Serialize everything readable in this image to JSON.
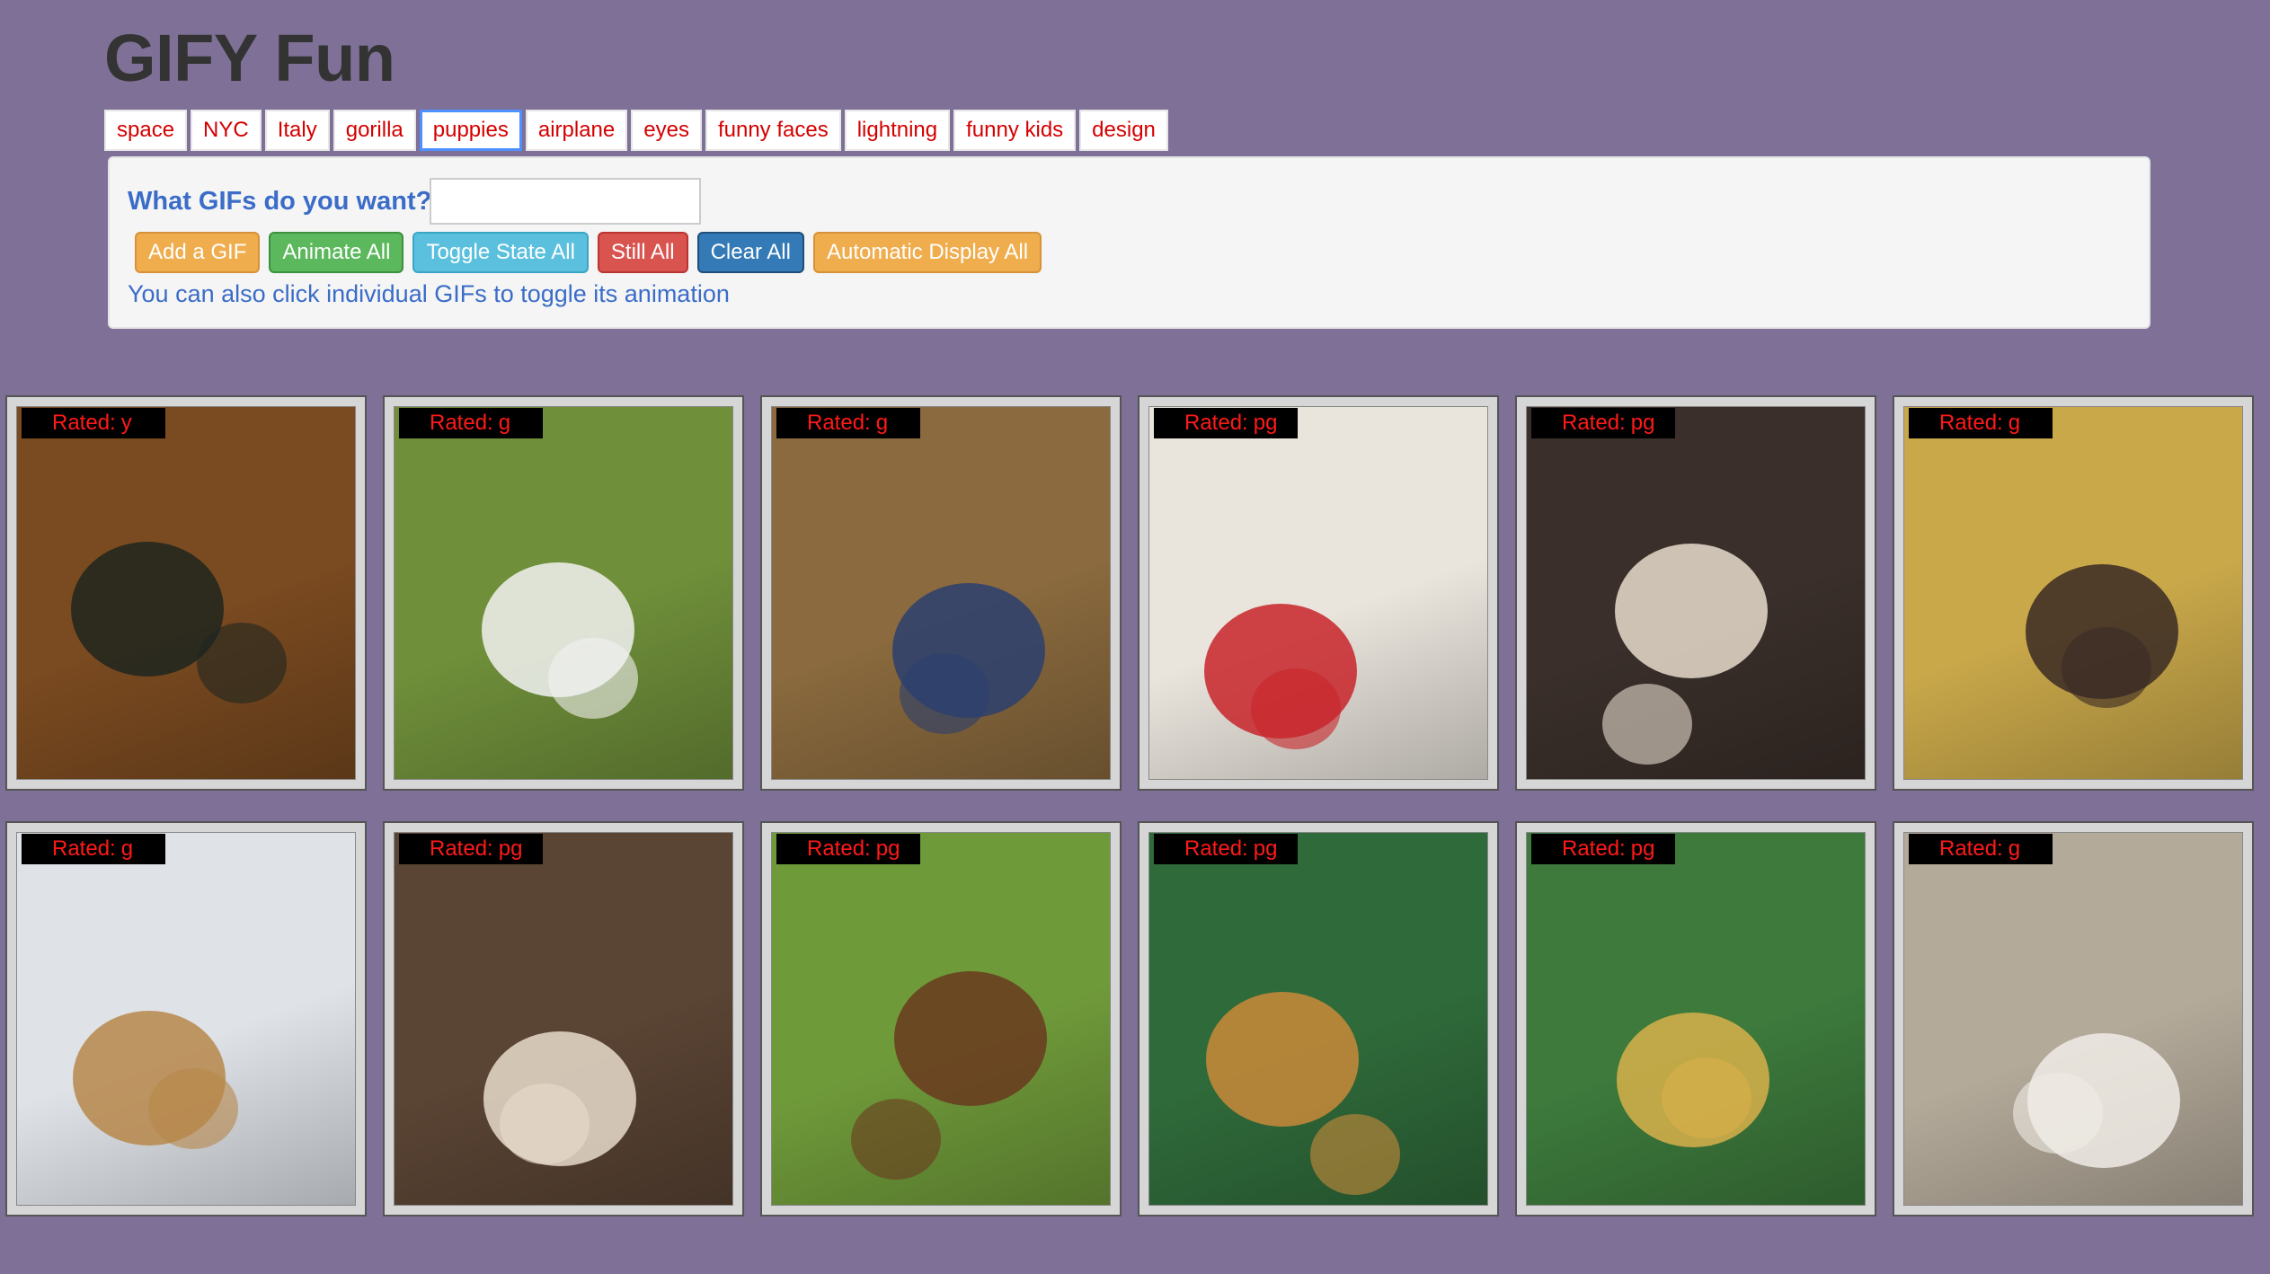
{
  "page": {
    "title": "GIFY Fun"
  },
  "topics": [
    {
      "label": "space",
      "active": false
    },
    {
      "label": "NYC",
      "active": false
    },
    {
      "label": "Italy",
      "active": false
    },
    {
      "label": "gorilla",
      "active": false
    },
    {
      "label": "puppies",
      "active": true
    },
    {
      "label": "airplane",
      "active": false
    },
    {
      "label": "eyes",
      "active": false
    },
    {
      "label": "funny faces",
      "active": false
    },
    {
      "label": "lightning",
      "active": false
    },
    {
      "label": "funny kids",
      "active": false
    },
    {
      "label": "design",
      "active": false
    }
  ],
  "controls": {
    "query_label": "What GIFs do you want?",
    "query_value": "",
    "add_label": "Add a GIF",
    "animate_label": "Animate All",
    "toggle_label": "Toggle State All",
    "still_label": "Still All",
    "clear_label": "Clear All",
    "auto_label": "Automatic Display All",
    "help_text": "You can also click individual GIFs to toggle its animation"
  },
  "rating_prefix": "Rated:",
  "gifs": [
    {
      "rating": "y",
      "bg": "#7a4a20",
      "fg": "#1f261f",
      "desc": "cartoon-dalmatian-puppies"
    },
    {
      "rating": "g",
      "bg": "#6f8f3a",
      "fg": "#f2f2f2",
      "desc": "puppies-in-laundry-basket"
    },
    {
      "rating": "g",
      "bg": "#8a6a3e",
      "fg": "#2b3f6e",
      "desc": "man-lying-with-pugs"
    },
    {
      "rating": "pg",
      "bg": "#e9e4dc",
      "fg": "#c8242a",
      "desc": "woman-with-puppy-umbrella"
    },
    {
      "rating": "pg",
      "bg": "#3a2f2a",
      "fg": "#e8dccd",
      "desc": "man-covered-in-puppies"
    },
    {
      "rating": "g",
      "bg": "#c9a84a",
      "fg": "#3a2a24",
      "desc": "woman-on-couch-with-pomeranians"
    },
    {
      "rating": "g",
      "bg": "#dfe3e8",
      "fg": "#b7874a",
      "desc": "golden-puppies-in-snow"
    },
    {
      "rating": "pg",
      "bg": "#5a4434",
      "fg": "#e7dccb",
      "desc": "dog-and-puppy"
    },
    {
      "rating": "pg",
      "bg": "#6f9a3a",
      "fg": "#6a3a1e",
      "desc": "hotdog-dachshunds-in-field"
    },
    {
      "rating": "pg",
      "bg": "#2f6a3a",
      "fg": "#c98a3a",
      "desc": "golden-retriever-bandana"
    },
    {
      "rating": "pg",
      "bg": "#3d7a3c",
      "fg": "#d8b04a",
      "desc": "puppy-bowl-field"
    },
    {
      "rating": "g",
      "bg": "#b4aa9a",
      "fg": "#f0ece6",
      "desc": "corgis-close-up"
    }
  ]
}
